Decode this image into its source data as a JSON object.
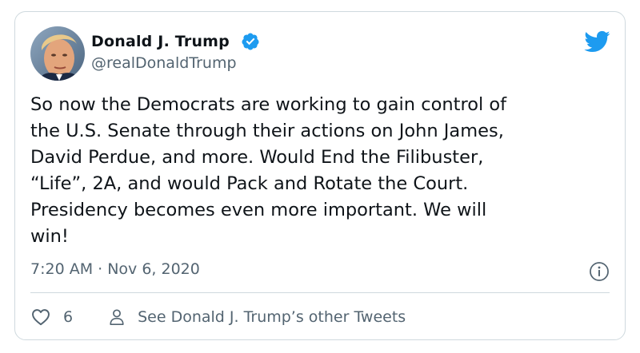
{
  "tweet": {
    "author_name": "Donald J. Trump",
    "handle": "@realDonaldTrump",
    "verified": true,
    "text": "So now the Democrats are working to gain control of\nthe U.S. Senate through their actions on John James,\nDavid Perdue, and more. Would End the Filibuster,\n“Life”, 2A, and would Pack and Rotate the Court.\nPresidency becomes even more important. We will\nwin!",
    "timestamp": "7:20 AM · Nov 6, 2020",
    "like_count": "6",
    "profile_link_label": "See Donald J. Trump’s other Tweets"
  },
  "icons": {
    "verified": "verified-badge-icon",
    "logo": "twitter-bird-icon",
    "info": "info-icon",
    "like": "heart-icon",
    "profile": "person-icon"
  },
  "colors": {
    "brand_blue": "#1d9bf0",
    "text_primary": "#0f1419",
    "text_secondary": "#536471",
    "border": "#cfd9de"
  }
}
